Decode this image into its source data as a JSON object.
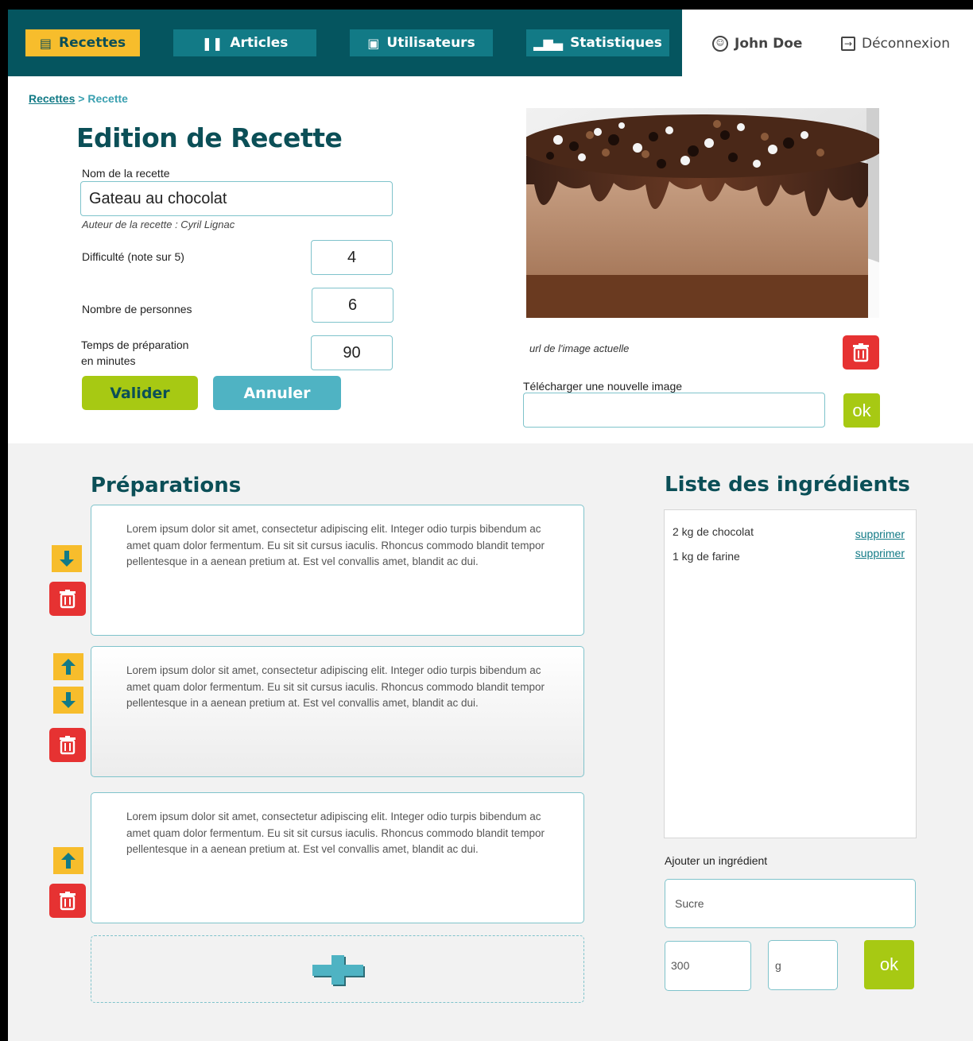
{
  "nav": {
    "items": [
      {
        "label": "Recettes",
        "icon": "recipe-icon"
      },
      {
        "label": "Articles",
        "icon": "cutlery-icon"
      },
      {
        "label": "Utilisateurs",
        "icon": "users-icon"
      },
      {
        "label": "Statistiques",
        "icon": "chart-icon"
      }
    ],
    "user_name": "John Doe",
    "logout_label": "Déconnexion"
  },
  "breadcrumb": {
    "parent": "Recettes",
    "separator": ">",
    "current": "Recette"
  },
  "form": {
    "title": "Edition de Recette",
    "name_label": "Nom de la recette",
    "name_value": "Gateau au chocolat",
    "author_text": "Auteur de la recette :  Cyril  Lignac",
    "difficulty_label": "Difficulté (note sur 5)",
    "difficulty_value": "4",
    "persons_label": "Nombre de personnes",
    "persons_value": "6",
    "prep_time_label_1": "Temps de préparation",
    "prep_time_label_2": "en minutes",
    "prep_time_value": "90",
    "submit_label": "Valider",
    "cancel_label": "Annuler"
  },
  "image": {
    "url_label": "url de l'image actuelle",
    "upload_label": "Télécharger une nouvelle image",
    "upload_value": "",
    "ok_label": "ok"
  },
  "preparations": {
    "title": "Préparations",
    "steps": [
      {
        "text": "Lorem ipsum dolor sit amet, consectetur adipiscing elit. Integer odio turpis bibendum ac amet quam dolor fermentum. Eu sit sit cursus iaculis. Rhoncus commodo blandit tempor pellentesque in a aenean pretium at. Est vel convallis amet, blandit ac dui."
      },
      {
        "text": "Lorem ipsum dolor sit amet, consectetur adipiscing elit. Integer odio turpis bibendum ac amet quam dolor fermentum. Eu sit sit cursus iaculis. Rhoncus commodo blandit tempor pellentesque in a aenean pretium at. Est vel convallis amet, blandit ac dui."
      },
      {
        "text": "Lorem ipsum dolor sit amet, consectetur adipiscing elit. Integer odio turpis bibendum ac amet quam dolor fermentum. Eu sit sit cursus iaculis. Rhoncus commodo blandit tempor pellentesque in a aenean pretium at. Est vel convallis amet, blandit ac dui."
      }
    ]
  },
  "ingredients": {
    "title": "Liste des ingrédients",
    "items": [
      {
        "text": "2 kg  de chocolat",
        "delete_label": "supprimer"
      },
      {
        "text": "1 kg  de farine",
        "delete_label": "supprimer"
      }
    ],
    "add_label": "Ajouter un ingrédient",
    "name_value": "Sucre",
    "quantity_value": "300",
    "unit_value": "g",
    "ok_label": "ok"
  },
  "colors": {
    "nav_bg": "#05555f",
    "nav_item": "#127a86",
    "nav_active": "#f7bd2c",
    "accent_green": "#a7c913",
    "accent_teal": "#4fb3c3",
    "danger": "#e63232"
  }
}
